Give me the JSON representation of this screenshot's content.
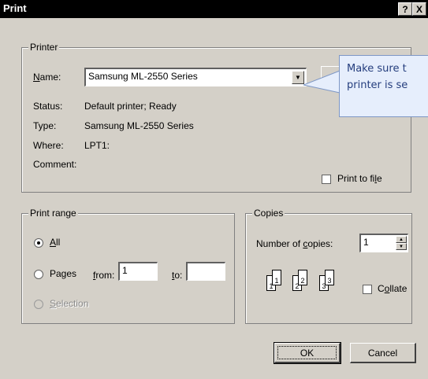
{
  "window": {
    "title": "Print",
    "help_label": "?",
    "close_label": "X"
  },
  "printer_group": {
    "title": "Printer",
    "name_label": "Name:",
    "name_value": "Samsung ML-2550 Series",
    "status_label": "Status:",
    "status_value": "Default printer; Ready",
    "type_label": "Type:",
    "type_value": "Samsung ML-2550 Series",
    "where_label": "Where:",
    "where_value": "LPT1:",
    "comment_label": "Comment:",
    "comment_value": "",
    "print_to_file_label": "Print to file",
    "print_to_file_checked": false
  },
  "print_range": {
    "title": "Print range",
    "all_label": "All",
    "pages_label": "Pages",
    "from_label": "from:",
    "from_value": "1",
    "to_label": "to:",
    "to_value": "",
    "selection_label": "Selection",
    "selected": "All"
  },
  "copies": {
    "title": "Copies",
    "number_label": "Number of copies:",
    "number_value": "1",
    "collate_label": "Collate",
    "collate_checked": false,
    "collate_pages": [
      "1",
      "1",
      "2",
      "2",
      "3",
      "3"
    ]
  },
  "buttons": {
    "ok_label": "OK",
    "cancel_label": "Cancel"
  },
  "tooltip": {
    "line1": "Make sure t",
    "line2": "printer is se"
  },
  "colors": {
    "dialog_bg": "#d4d0c8",
    "titlebar_bg": "#000000",
    "tooltip_bg": "#e6eefc",
    "tooltip_text": "#243d7d"
  }
}
